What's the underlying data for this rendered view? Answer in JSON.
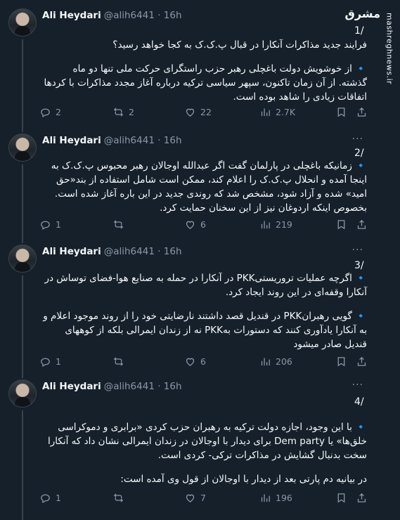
{
  "watermark": {
    "site": "mashreghnews.ir",
    "logo": "مشرق"
  },
  "tweets": [
    {
      "name": "Ali Heydari",
      "handle": "@alih6441 · 16h",
      "number": "1/",
      "paragraphs": [
        "فرایند جدید مذاکرات آنکارا در قبال پ.ک.ک به کجا خواهد رسید؟",
        "🔹 از خوشویش دولت باغچلی رهبر حزب راستگرای حرکت ملی تنها دو ماه گذشته. از آن زمان تاکنون، سپهر سیاسی ترکیه درباره آغاز مجدد مذاکرات با کردها اتفاقات زیادی را شاهد بوده است."
      ],
      "stats": {
        "replies": "2",
        "retweets": "2",
        "likes": "22",
        "views": "2.7K"
      }
    },
    {
      "name": "Ali Heydari",
      "handle": "@alih6441 · 16h",
      "number": "2/",
      "paragraphs": [
        "🔹 زمانیکه باغچلی در پارلمان گفت اگر عبدالله اوجالان رهبر محبوس پ.ک.ک به اینجا آمده و انحلال پ.ک.ک را اعلام کند، ممکن است شامل استفاده از بند«حق امید» شده و آزاد شود، مشخص شد که روندی جدید در این باره آغاز شده است. بخصوص اینکه اردوغان نیز از این سخنان حمایت کرد."
      ],
      "stats": {
        "replies": "1",
        "retweets": "",
        "likes": "6",
        "views": "219"
      }
    },
    {
      "name": "Ali Heydari",
      "handle": "@alih6441 · 16h",
      "number": "3/",
      "paragraphs": [
        "🔹 اگرچه عملیات تروریستیPKK در آنکارا در حمله به صنایع هوا-فضای توساش در آنکارا وقفه‌ای در این روند ایجاد کرد.",
        "🔹 گویی رهبرانPKK در قندیل قصد داشتند نارضایتی خود را از روند موجود اعلام و به آنکارا یادآوری کنند که دستورات بهPKK نه از زندان ایمرالی بلکه از کوههای قندیل صادر میشود"
      ],
      "stats": {
        "replies": "1",
        "retweets": "",
        "likes": "6",
        "views": "206"
      }
    },
    {
      "name": "Ali Heydari",
      "handle": "@alih6441 · 16h",
      "number": "4/",
      "paragraphs": [
        "🔹 با این وجود، اجازه دولت ترکیه به رهبران حزب کردی «برابری و دموکراسی خلق‌ها» یا Dem party برای دیدار با اوجالان در زندان ایمرالی نشان داد که آنکارا سخت بدنبال گشایش در مذاکرات ترکی- کردی است.",
        "در بیانیه دم پارتی بعد از دیدار با اوجالان از قول وی آمده است:"
      ],
      "stats": {
        "replies": "1",
        "retweets": "",
        "likes": "7",
        "views": "196"
      }
    }
  ]
}
